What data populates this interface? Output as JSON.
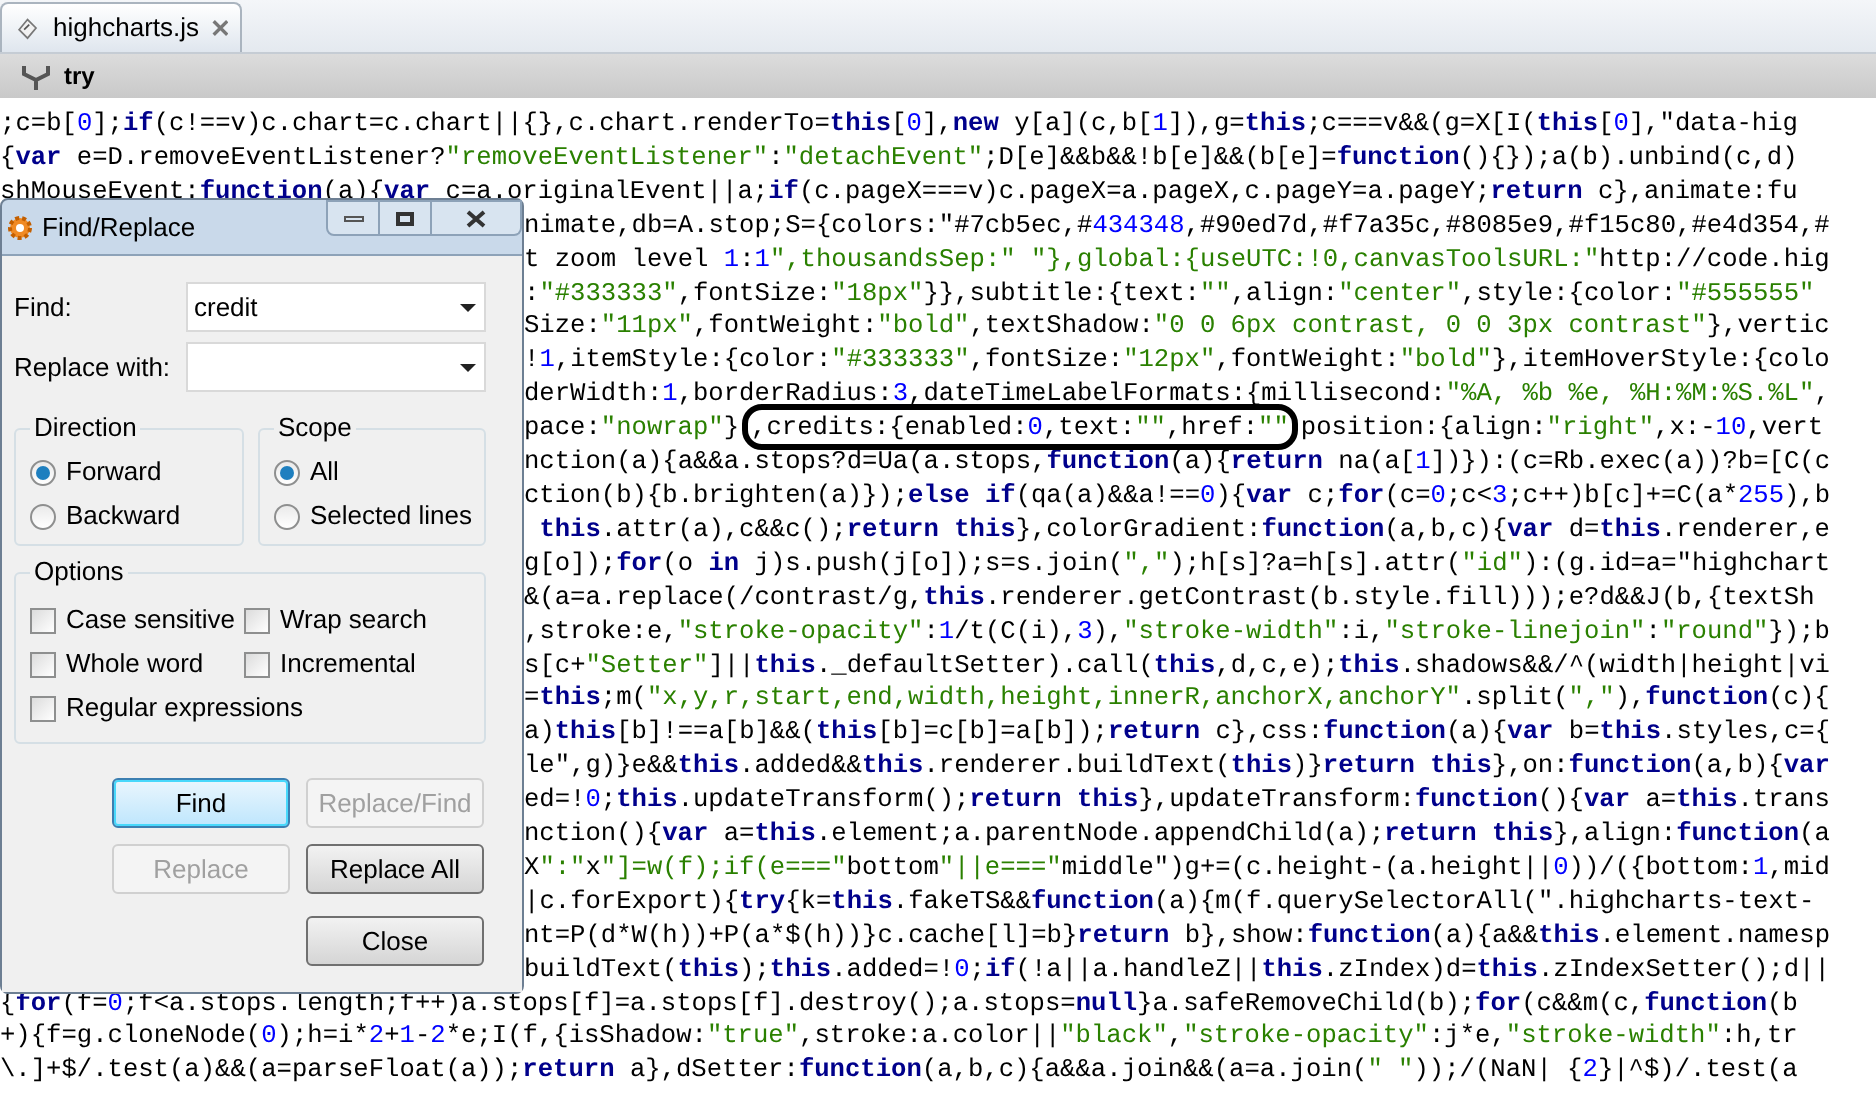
{
  "editor": {
    "tab": {
      "title": "highcharts.js",
      "selected": true
    },
    "toolbar": {
      "label": "try"
    },
    "code_lines": [
      {
        "kind": "full",
        "text": ";c=b[0];if(c!==v)c.chart=c.chart||{},c.chart.renderTo=this[0],new y[a](c,b[1]),g=this;c===v&&(g=X[I(this[0],\"data-hig"
      },
      {
        "kind": "full",
        "text": "{var e=D.removeEventListener?\"removeEventListener\":\"detachEvent\";D[e]&&b&&!b[e]&&(b[e]=function(){});a(b).unbind(c,d)"
      },
      {
        "kind": "full",
        "text": "shMouseEvent:function(a){var c=a.originalEvent||a;if(c.pageX===v)c.pageX=a.pageX,c.pageY=a.pageY;return c},animate:fu"
      },
      {
        "kind": "clipped",
        "text": "nimate,db=A.stop;S={colors:\"#7cb5ec,#434348,#90ed7d,#f7a35c,#8085e9,#f15c80,#e4d354,#"
      },
      {
        "kind": "clipped",
        "text": "t zoom level 1:1\",thousandsSep:\" \"},global:{useUTC:!0,canvasToolsURL:\"http://code.hig"
      },
      {
        "kind": "clipped",
        "text": ":\"#333333\",fontSize:\"18px\"}},subtitle:{text:\"\",align:\"center\",style:{color:\"#555555\""
      },
      {
        "kind": "clipped",
        "text": "Size:\"11px\",fontWeight:\"bold\",textShadow:\"0 0 6px contrast, 0 0 3px contrast\"},vertic"
      },
      {
        "kind": "clipped",
        "text": "!1,itemStyle:{color:\"#333333\",fontSize:\"12px\",fontWeight:\"bold\"},itemHoverStyle:{colo"
      },
      {
        "kind": "clipped",
        "text": "derWidth:1,borderRadius:3,dateTimeLabelFormats:{millisecond:\"%A, %b %e, %H:%M:%S.%L\","
      },
      {
        "kind": "circled",
        "before": "pace:\"nowrap\"}",
        "circled": ",credits:{enabled:0,text:\"\",href:\"\"",
        "after": "position:{align:\"right\",x:-10,vert"
      },
      {
        "kind": "clipped",
        "text": "nction(a){a&&a.stops?d=Ua(a.stops,function(a){return na(a[1])}):(c=Rb.exec(a))?b=[C(c"
      },
      {
        "kind": "clipped",
        "text": "ction(b){b.brighten(a)});else if(qa(a)&&a!==0){var c;for(c=0;c<3;c++)b[c]+=C(a*255),b"
      },
      {
        "kind": "clipped",
        "text": " this.attr(a),c&&c();return this},colorGradient:function(a,b,c){var d=this.renderer,e"
      },
      {
        "kind": "clipped",
        "text": "g[o]);for(o in j)s.push(j[o]);s=s.join(\",\");h[s]?a=h[s].attr(\"id\"):(g.id=a=\"highchart"
      },
      {
        "kind": "clipped",
        "text": "&(a=a.replace(/contrast/g,this.renderer.getContrast(b.style.fill)));e?d&&J(b,{textSh"
      },
      {
        "kind": "clipped",
        "text": ",stroke:e,\"stroke-opacity\":1/t(C(i),3),\"stroke-width\":i,\"stroke-linejoin\":\"round\"});b"
      },
      {
        "kind": "clipped",
        "text": "s[c+\"Setter\"]||this._defaultSetter).call(this,d,c,e);this.shadows&&/^(width|height|vi"
      },
      {
        "kind": "clipped",
        "text": "=this;m(\"x,y,r,start,end,width,height,innerR,anchorX,anchorY\".split(\",\"),function(c){"
      },
      {
        "kind": "clipped",
        "text": "a)this[b]!==a[b]&&(this[b]=c[b]=a[b]);return c},css:function(a){var b=this.styles,c={"
      },
      {
        "kind": "clipped",
        "text": "le\",g)}e&&this.added&&this.renderer.buildText(this)}return this},on:function(a,b){var"
      },
      {
        "kind": "clipped",
        "text": "ed=!0;this.updateTransform();return this},updateTransform:function(){var a=this.trans"
      },
      {
        "kind": "clipped",
        "text": "nction(){var a=this.element;a.parentNode.appendChild(a);return this},align:function(a"
      },
      {
        "kind": "clipped",
        "text": "X\":\"x\"]=w(f);if(e===\"bottom\"||e===\"middle\")g+=(c.height-(a.height||0))/({bottom:1,mid"
      },
      {
        "kind": "clipped",
        "text": "|c.forExport){try{k=this.fakeTS&&function(a){m(f.querySelectorAll(\".highcharts-text-"
      },
      {
        "kind": "clipped",
        "text": "nt=P(d*W(h))+P(a*$(h))}c.cache[l]=b}return b},show:function(a){a&&this.element.namesp"
      },
      {
        "kind": "clipped",
        "text": "buildText(this);this.added=!0;if(!a||a.handleZ||this.zIndex)d=this.zIndexSetter();d||"
      },
      {
        "kind": "full",
        "text": "{for(f=0;f<a.stops.length;f++)a.stops[f]=a.stops[f].destroy();a.stops=null}a.safeRemoveChild(b);for(c&&m(c,function(b"
      },
      {
        "kind": "full",
        "text": "+){f=g.cloneNode(0);h=i*2+1-2*e;I(f,{isShadow:\"true\",stroke:a.color||\"black\",\"stroke-opacity\":j*e,\"stroke-width\":h,tr"
      },
      {
        "kind": "full",
        "text": "\\.]+$/.test(a)&&(a=parseFloat(a));return a},dSetter:function(a,b,c){a&&a.join&&(a=a.join(\" \"));/(NaN| {2}|^$)/.test(a"
      }
    ]
  },
  "dialog": {
    "title": "Find/Replace",
    "find": {
      "label": "Find:",
      "value": "credit"
    },
    "replace": {
      "label": "Replace with:"
    },
    "direction": {
      "label": "Direction",
      "options": [
        {
          "label": "Forward",
          "selected": true
        },
        {
          "label": "Backward",
          "selected": false
        }
      ]
    },
    "scope": {
      "label": "Scope",
      "options": [
        {
          "label": "All",
          "selected": true
        },
        {
          "label": "Selected lines",
          "selected": false
        }
      ]
    },
    "options": {
      "label": "Options",
      "items": [
        {
          "label": "Case sensitive",
          "checked": false
        },
        {
          "label": "Wrap search",
          "checked": false
        },
        {
          "label": "Whole word",
          "checked": false
        },
        {
          "label": "Incremental",
          "checked": false
        },
        {
          "label": "Regular expressions",
          "checked": false
        }
      ]
    },
    "buttons": [
      {
        "label": "Find",
        "disabled": false,
        "default": true
      },
      {
        "label": "Replace/Find",
        "disabled": true,
        "default": false
      },
      {
        "label": "Replace",
        "disabled": true,
        "default": false
      },
      {
        "label": "Replace All",
        "disabled": false,
        "default": false
      },
      {
        "label": "Close",
        "disabled": false,
        "default": false
      }
    ]
  }
}
